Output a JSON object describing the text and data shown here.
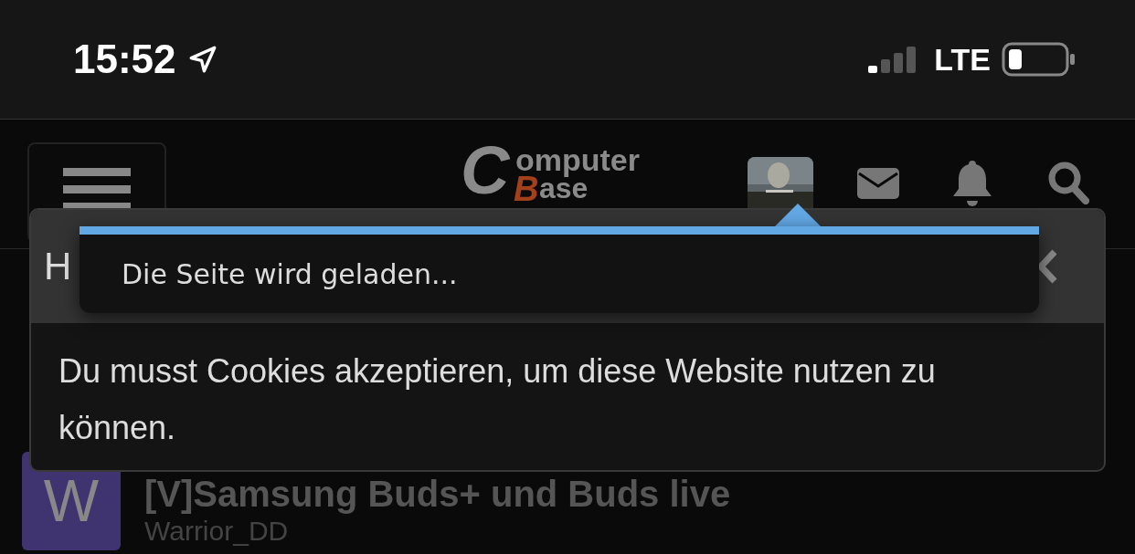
{
  "status_bar": {
    "time": "15:52",
    "network": "LTE"
  },
  "header": {
    "logo": [
      "C",
      "omputer",
      "B",
      "ase"
    ]
  },
  "dialog": {
    "title": "H",
    "message": "Du musst Cookies akzeptieren, um diese Website nutzen zu können."
  },
  "toast": {
    "text": "Die Seite wird geladen..."
  },
  "threads": [
    {
      "avatar": "W",
      "color": "#3f3370",
      "title": "[V]Samsung Buds+ und Buds live",
      "author": "Warrior_DD"
    }
  ]
}
